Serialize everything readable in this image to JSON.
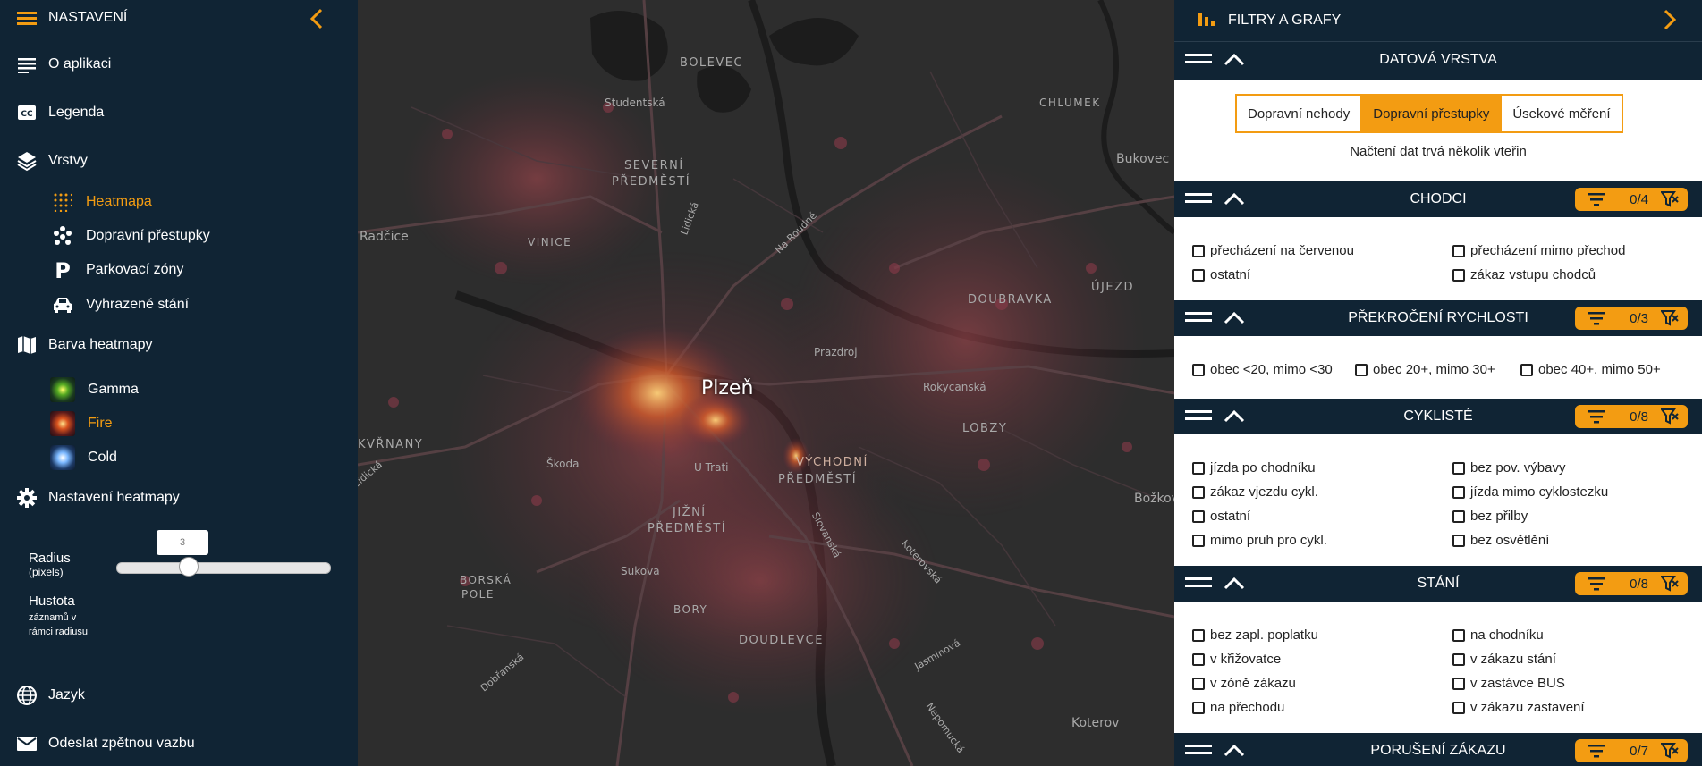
{
  "left": {
    "header_title": "NASTAVENÍ",
    "about": "O aplikaci",
    "legend": "Legenda",
    "layers": "Vrstvy",
    "layer_items": [
      "Heatmapa",
      "Dopravní přestupky",
      "Parkovací zóny",
      "Vyhrazené stání"
    ],
    "heat_color": "Barva heatmapy",
    "color_items": [
      "Gamma",
      "Fire",
      "Cold"
    ],
    "heat_settings": "Nastavení heatmapy",
    "radius_label": "Radius",
    "radius_unit": "(pixels)",
    "radius_value": "3",
    "radius_fraction": 0.32,
    "density_label": "Hustota",
    "density_sub1": "záznamů v",
    "density_sub2": "rámci radiusu",
    "language": "Jazyk",
    "feedback": "Odeslat zpětnou vazbu"
  },
  "map": {
    "city": "Plzeň",
    "labels": [
      "BOLEVEC",
      "Studentská",
      "SEVERNÍ",
      "PŘEDMĚSTÍ",
      "VINICE",
      "Radčice",
      "Lidická",
      "Na Roudné",
      "CHLUMEK",
      "Bukovec",
      "DOUBRAVKA",
      "ÚJEZD",
      "Prazdroj",
      "Rokycanská",
      "LOBZY",
      "KVŘNANY",
      "Škoda",
      "U Trati",
      "VÝCHODNÍ",
      "PŘEDMĚSTÍ",
      "JIŽNÍ",
      "PŘEDMĚSTÍ",
      "Slovanská",
      "Koterovská",
      "Božkov",
      "BORSKÁ",
      "POLE",
      "Sukova",
      "BORY",
      "DOUDLEVCE",
      "Jasmínová",
      "Dobřanská",
      "Nepomucká",
      "Koterov",
      "Lidická"
    ]
  },
  "right": {
    "title": "FILTRY A GRAFY",
    "datova": {
      "title": "DATOVÁ VRSTVA",
      "tabs": [
        "Dopravní nehody",
        "Dopravní přestupky",
        "Úsekové měření"
      ],
      "note": "Načtení dat trvá několik vteřin"
    },
    "chodci": {
      "title": "CHODCI",
      "count": "0/4",
      "items": [
        "přecházení na červenou",
        "přecházení mimo přechod",
        "ostatní",
        "zákaz vstupu chodců"
      ]
    },
    "rychlost": {
      "title": "PŘEKROČENÍ RYCHLOSTI",
      "count": "0/3",
      "items": [
        "obec <20, mimo <30",
        "obec 20+, mimo 30+",
        "obec 40+, mimo 50+"
      ]
    },
    "cyklisti": {
      "title": "CYKLISTÉ",
      "count": "0/8",
      "items": [
        "jízda po chodníku",
        "bez pov. výbavy",
        "zákaz vjezdu cykl.",
        "jízda mimo cyklostezku",
        "ostatní",
        "bez přilby",
        "mimo pruh pro cykl.",
        "bez osvětlění"
      ]
    },
    "stani": {
      "title": "STÁNÍ",
      "count": "0/8",
      "items": [
        "bez zapl. poplatku",
        "na chodníku",
        "v křižovatce",
        "v zákazu stání",
        "v zóně zákazu",
        "v zastávce BUS",
        "na přechodu",
        "v zákazu zastavení"
      ]
    },
    "poruseni": {
      "title": "PORUŠENÍ ZÁKAZU",
      "count": "0/7"
    }
  },
  "colors": {
    "accent": "#f39c12",
    "navy": "#102434"
  }
}
